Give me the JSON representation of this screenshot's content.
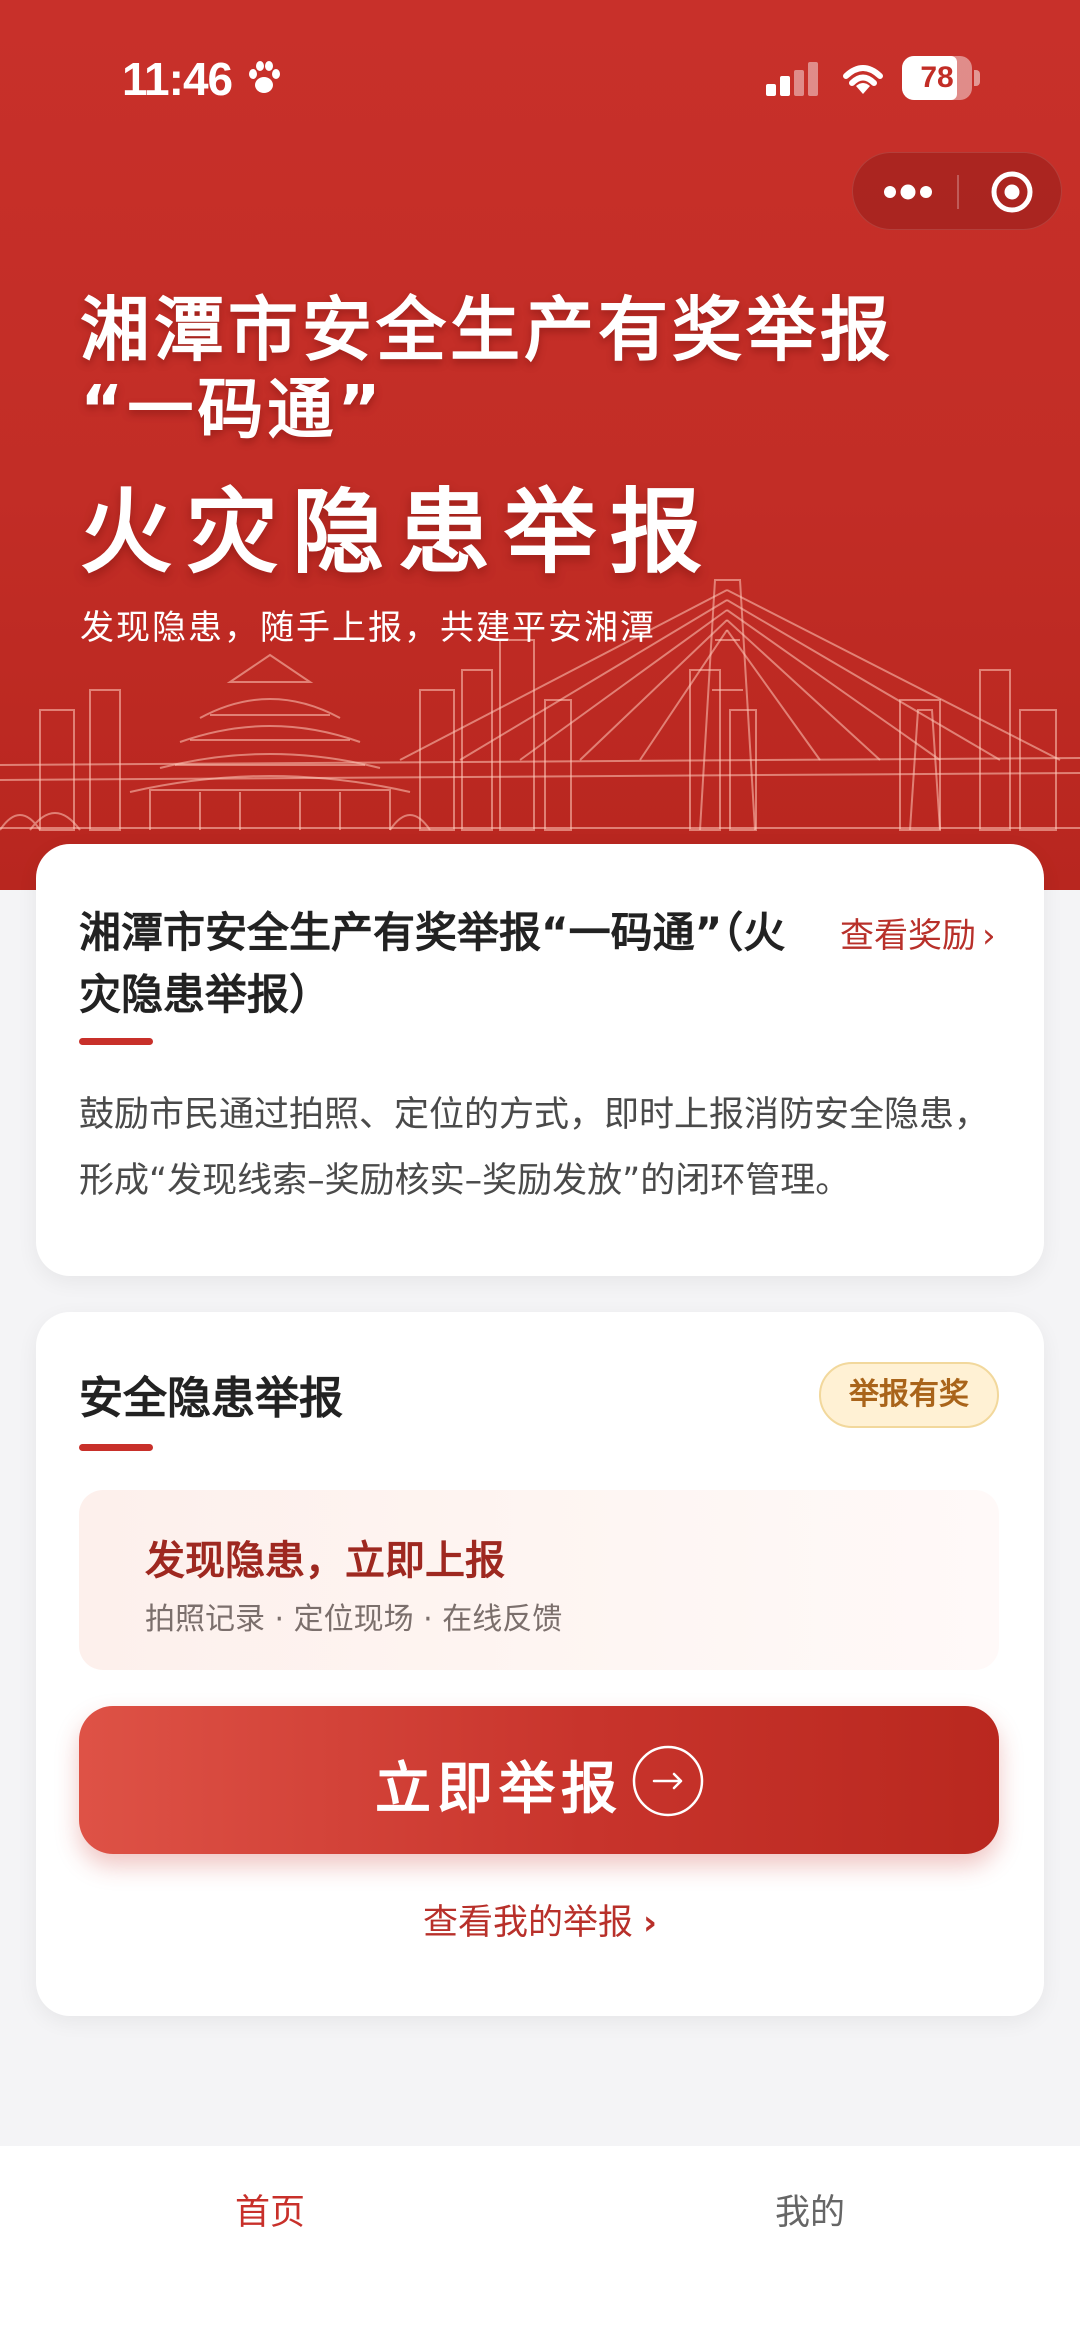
{
  "status_bar": {
    "time": "11:46",
    "battery": "78",
    "icons": [
      "paw-icon",
      "signal-icon",
      "wifi-icon",
      "battery-icon"
    ]
  },
  "capsule": {
    "icons": [
      "more-icon",
      "close-target-icon"
    ]
  },
  "hero": {
    "title_line1": "湘潭市安全生产有奖举报",
    "title_line2": "“一码通”",
    "title_line3": "火灾隐患举报",
    "subtitle": "发现隐患，随手上报，共建平安湘潭"
  },
  "intro_card": {
    "title": "湘潭市安全生产有奖举报“一码通”（火灾隐患举报）",
    "reward_link": "查看奖励",
    "description": "鼓励市民通过拍照、定位的方式，即时上报消防安全隐患，形成“发现线索–奖励核实–奖励发放”的闭环管理。"
  },
  "report_card": {
    "title": "安全隐患举报",
    "badge": "举报有奖",
    "promo_title": "发现隐患，立即上报",
    "promo_subtitle": "拍照记录 · 定位现场 · 在线反馈",
    "button_label": "立即举报",
    "my_reports_link": "查看我的举报"
  },
  "tab_bar": {
    "tabs": [
      {
        "label": "首页",
        "active": true
      },
      {
        "label": "我的",
        "active": false
      }
    ]
  },
  "colors": {
    "brand_red": "#c8302a",
    "link_red": "#b8302a",
    "badge_bg": "#fff1d4",
    "badge_text": "#a9641a"
  }
}
